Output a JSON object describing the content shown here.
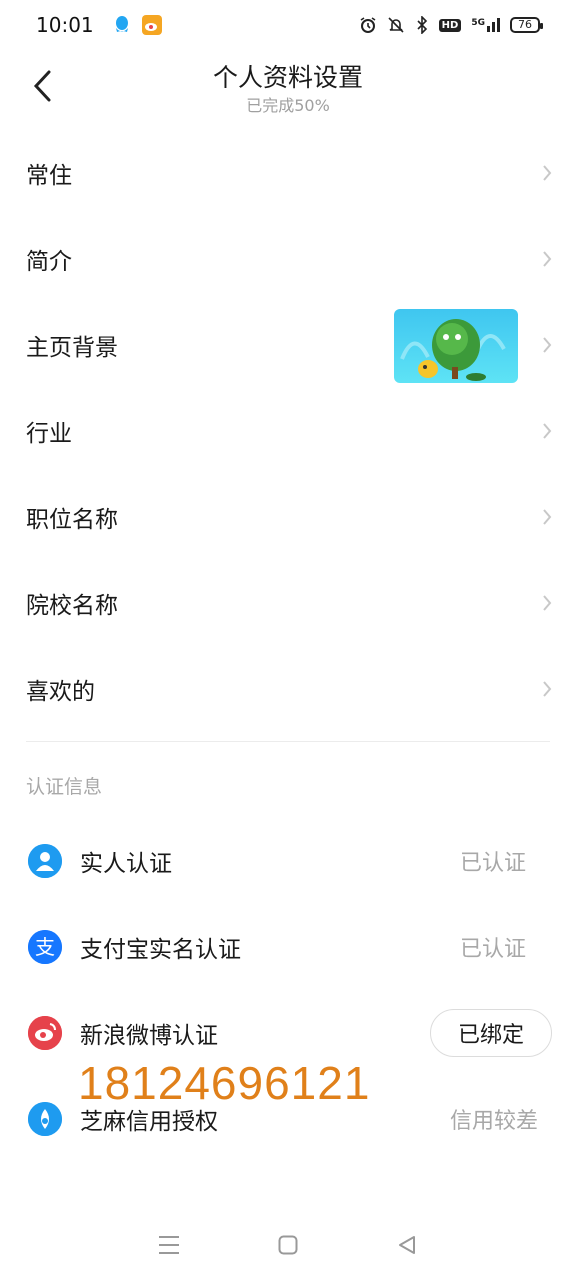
{
  "status_bar": {
    "time": "10:01",
    "battery": "76",
    "network": "5G",
    "hd": "HD"
  },
  "header": {
    "title": "个人资料设置",
    "subtitle": "已完成50%"
  },
  "settings": {
    "items": [
      {
        "label": "常住"
      },
      {
        "label": "简介"
      },
      {
        "label": "主页背景"
      },
      {
        "label": "行业"
      },
      {
        "label": "职位名称"
      },
      {
        "label": "院校名称"
      },
      {
        "label": "喜欢的"
      }
    ]
  },
  "verification": {
    "section_title": "认证信息",
    "items": [
      {
        "label": "实人认证",
        "status": "已认证",
        "icon": "person-icon",
        "color": "#1e9bf0"
      },
      {
        "label": "支付宝实名认证",
        "status": "已认证",
        "icon": "alipay-icon",
        "color": "#1677ff"
      },
      {
        "label": "新浪微博认证",
        "status": "已绑定",
        "icon": "weibo-icon",
        "color": "#e6424b"
      },
      {
        "label": "芝麻信用授权",
        "status": "信用较差",
        "icon": "sesame-icon",
        "color": "#1e9bf0"
      }
    ]
  },
  "watermark": "18124696121",
  "colors": {
    "accent_blue": "#1e9bf0",
    "watermark_orange": "#e0801a",
    "muted_text": "#a8a8a8"
  }
}
